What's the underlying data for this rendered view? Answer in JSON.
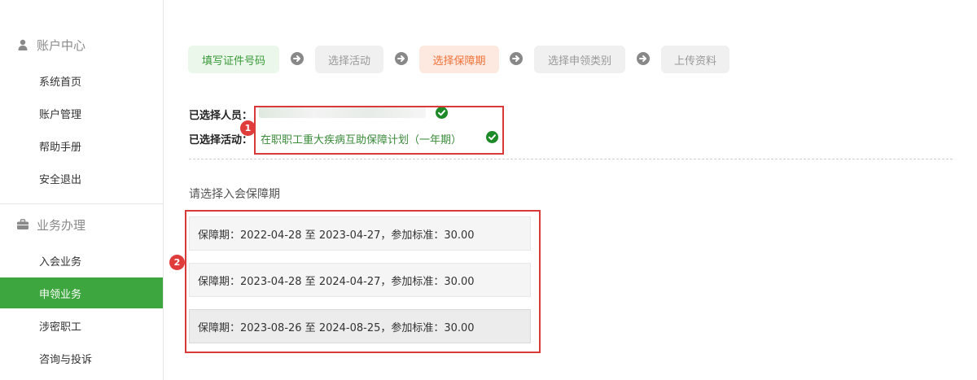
{
  "sidebar": {
    "account_section": {
      "title": "账户中心",
      "icon": "user-icon"
    },
    "account_items": [
      {
        "label": "系统首页"
      },
      {
        "label": "账户管理"
      },
      {
        "label": "帮助手册"
      },
      {
        "label": "安全退出"
      }
    ],
    "business_section": {
      "title": "业务办理",
      "icon": "briefcase-icon"
    },
    "business_items": [
      {
        "label": "入会业务"
      },
      {
        "label": "申领业务",
        "active": true
      },
      {
        "label": "涉密职工"
      },
      {
        "label": "咨询与投诉"
      }
    ]
  },
  "steps": [
    {
      "label": "填写证件号码",
      "state": "done"
    },
    {
      "label": "选择活动",
      "state": "todo"
    },
    {
      "label": "选择保障期",
      "state": "current"
    },
    {
      "label": "选择申领类别",
      "state": "todo"
    },
    {
      "label": "上传资料",
      "state": "todo"
    }
  ],
  "selected": {
    "person_label": "已选择人员：",
    "activity_label": "已选择活动：",
    "activity_value": "在职职工重大疾病互助保障计划（一年期）"
  },
  "annotations": {
    "badge1": "1",
    "badge2": "2"
  },
  "period_section": {
    "prompt": "请选择入会保障期",
    "options": [
      {
        "text": "保障期：2022-04-28 至 2023-04-27，参加标准：30.00"
      },
      {
        "text": "保障期：2023-04-28 至 2024-04-27，参加标准：30.00"
      },
      {
        "text": "保障期：2023-08-26 至 2024-08-25，参加标准：30.00",
        "hovered": true
      }
    ]
  },
  "colors": {
    "accent_green": "#3ea63e",
    "current_step_orange": "#f0723a",
    "annotation_red": "#d83a3a"
  }
}
